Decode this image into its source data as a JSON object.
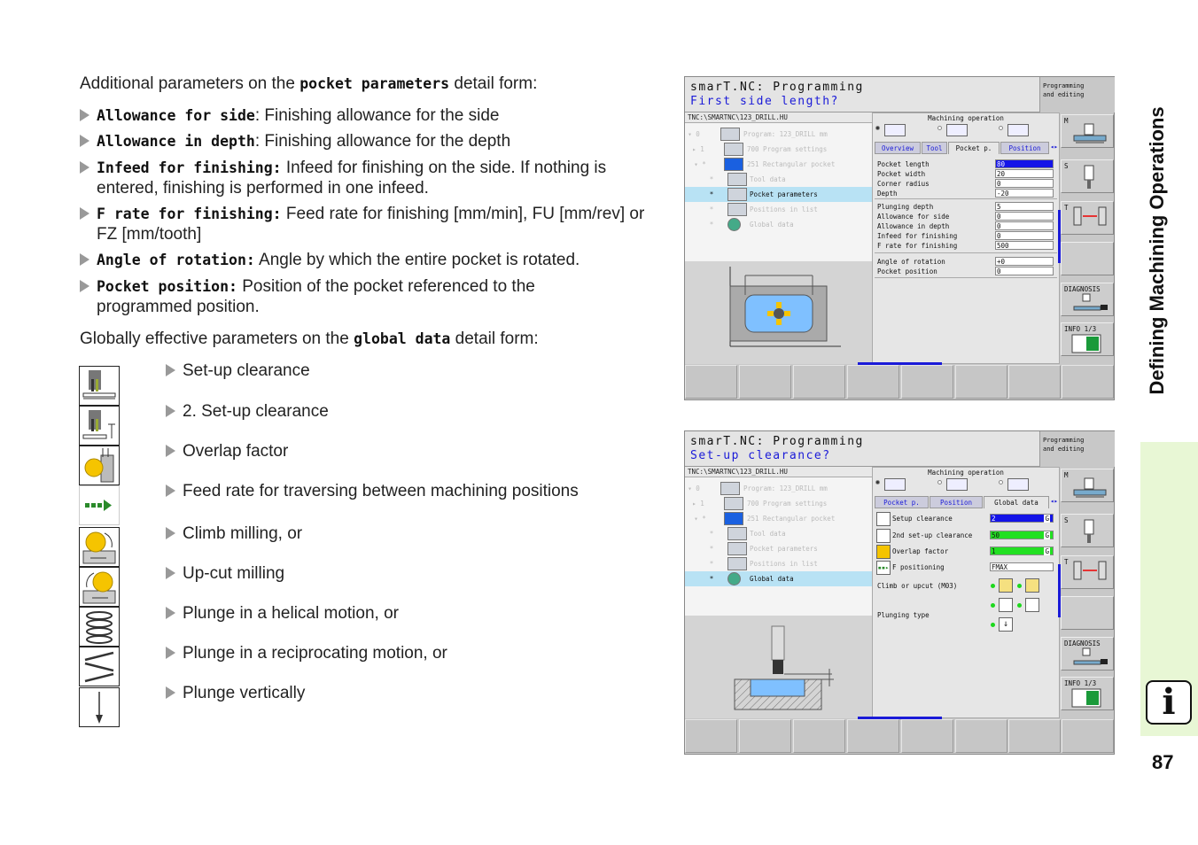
{
  "doc": {
    "intro_pre": "Additional parameters on the ",
    "intro_code": "pocket parameters",
    "intro_post": " detail form:",
    "bullets": [
      {
        "term": "Allowance for side",
        "sep": ": ",
        "text": "Finishing allowance for the side"
      },
      {
        "term": "Allowance in depth",
        "sep": ": ",
        "text": "Finishing allowance for the depth"
      },
      {
        "term": "Infeed for finishing:",
        "sep": " ",
        "text": "Infeed for finishing on the side. If nothing is entered, finishing is performed in one infeed."
      },
      {
        "term": "F rate for finishing:",
        "sep": " ",
        "text": "Feed rate for finishing [mm/min], FU [mm/rev] or FZ [mm/tooth]"
      },
      {
        "term": "Angle of rotation:",
        "sep": " ",
        "text": "Angle by which the entire pocket is rotated."
      },
      {
        "term": "Pocket position:",
        "sep": " ",
        "text": "Position of the pocket referenced to the programmed position."
      }
    ],
    "global_pre": "Globally effective parameters on the ",
    "global_code": "global data",
    "global_post": " detail form:",
    "global_items": [
      {
        "icon": "setup-clearance-icon",
        "text": "Set-up clearance"
      },
      {
        "icon": "second-setup-clearance-icon",
        "text": "2. Set-up clearance"
      },
      {
        "icon": "overlap-factor-icon",
        "text": "Overlap factor"
      },
      {
        "icon": "feed-rate-traverse-icon",
        "text": "Feed rate for traversing between machining positions"
      },
      {
        "icon": "climb-milling-icon",
        "text": "Climb milling, or"
      },
      {
        "icon": "upcut-milling-icon",
        "text": "Up-cut milling"
      },
      {
        "icon": "helical-plunge-icon",
        "text": "Plunge in a helical motion, or"
      },
      {
        "icon": "reciprocating-plunge-icon",
        "text": "Plunge in a reciprocating motion, or"
      },
      {
        "icon": "vertical-plunge-icon",
        "text": "Plunge vertically"
      }
    ]
  },
  "sidebar": {
    "chapter_title": "Defining Machining Operations",
    "info_icon": "i",
    "page_number": "87"
  },
  "screens": [
    {
      "title": "smarT.NC: Programming",
      "prompt": "First side length?",
      "mode": [
        "Programming",
        "and editing"
      ],
      "path": "TNC:\\SMARTNC\\123_DRILL.HU",
      "tree": [
        {
          "mark": "▾ 0",
          "label": "Program: 123_DRILL mm",
          "selected": false
        },
        {
          "mark": "▸ 1",
          "label": "700 Program settings",
          "selected": false
        },
        {
          "mark": "▾ *",
          "label": "251 Rectangular pocket",
          "selected": false
        },
        {
          "mark": "*",
          "label": "Tool data",
          "selected": false
        },
        {
          "mark": "*",
          "label": "Pocket parameters",
          "selected": true
        },
        {
          "mark": "*",
          "label": "Positions in list",
          "selected": false
        },
        {
          "mark": "*",
          "label": "Global data",
          "selected": false
        }
      ],
      "machining_operation": "Machining operation",
      "tabs": [
        "Overview",
        "Tool",
        "Pocket p.",
        "Position"
      ],
      "active_tab": "Pocket p.",
      "groups": [
        [
          {
            "label": "Pocket length",
            "value": "80",
            "style": "blue"
          },
          {
            "label": "Pocket width",
            "value": "20"
          },
          {
            "label": "Corner radius",
            "value": "0"
          },
          {
            "label": "Depth",
            "value": "-20"
          }
        ],
        [
          {
            "label": "Plunging depth",
            "value": "5"
          },
          {
            "label": "Allowance for side",
            "value": "0"
          },
          {
            "label": "Allowance in depth",
            "value": "0"
          },
          {
            "label": "Infeed for finishing",
            "value": "0"
          },
          {
            "label": "F rate for finishing",
            "value": "500"
          }
        ],
        [
          {
            "label": "Angle of rotation",
            "value": "+0"
          },
          {
            "label": "Pocket position",
            "value": "0"
          }
        ]
      ],
      "softkeys_right": [
        "M",
        "S",
        "T",
        "",
        "DIAGNOSIS",
        "INFO 1/3"
      ]
    },
    {
      "title": "smarT.NC: Programming",
      "prompt": "Set-up clearance?",
      "mode": [
        "Programming",
        "and editing"
      ],
      "path": "TNC:\\SMARTNC\\123_DRILL.HU",
      "tree": [
        {
          "mark": "▾ 0",
          "label": "Program: 123_DRILL mm",
          "selected": false
        },
        {
          "mark": "▸ 1",
          "label": "700 Program settings",
          "selected": false
        },
        {
          "mark": "▾ *",
          "label": "251 Rectangular pocket",
          "selected": false
        },
        {
          "mark": "*",
          "label": "Tool data",
          "selected": false
        },
        {
          "mark": "*",
          "label": "Pocket parameters",
          "selected": false
        },
        {
          "mark": "*",
          "label": "Positions in list",
          "selected": false
        },
        {
          "mark": "*",
          "label": "Global data",
          "selected": true
        }
      ],
      "machining_operation": "Machining operation",
      "tabs": [
        "Pocket p.",
        "Position",
        "Global data"
      ],
      "active_tab": "Global data",
      "global_rows": [
        {
          "label": "Setup clearance",
          "value": "2",
          "style": "blue",
          "flag": "G"
        },
        {
          "label": "2nd set-up clearance",
          "value": "50",
          "style": "green",
          "flag": "G"
        },
        {
          "label": "Overlap factor",
          "value": "1",
          "style": "green",
          "flag": "G"
        },
        {
          "label": "F positioning",
          "value": "FMAX",
          "flag": ""
        }
      ],
      "climb_label": "Climb or upcut (M03)",
      "plunge_label": "Plunging type",
      "softkeys_right": [
        "M",
        "S",
        "T",
        "",
        "DIAGNOSIS",
        "INFO 1/3"
      ]
    }
  ]
}
